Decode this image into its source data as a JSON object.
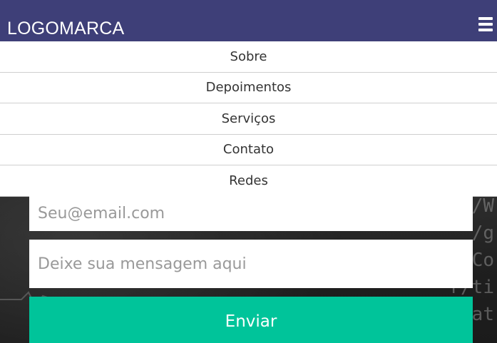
{
  "header": {
    "logo_text": "LOGOMARCA",
    "menu_icon": "hamburger-icon"
  },
  "nav": {
    "items": [
      {
        "label": "Sobre"
      },
      {
        "label": "Depoimentos"
      },
      {
        "label": "Serviços"
      },
      {
        "label": "Contato"
      },
      {
        "label": "Redes"
      }
    ]
  },
  "form": {
    "email_placeholder": "Seu@email.com",
    "message_placeholder": "Deixe sua mensagem aqui",
    "submit_label": "Enviar"
  },
  "colors": {
    "header_bg": "#3e3f78",
    "submit_bg": "#00c49a",
    "nav_bg": "#ffffff"
  }
}
